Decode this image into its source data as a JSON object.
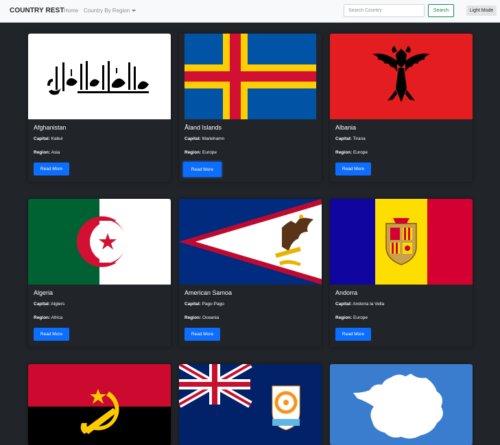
{
  "navbar": {
    "brand": "COUNTRY REST",
    "home": "Home",
    "region_dropdown": "Country By Region",
    "search_placeholder": "Search Country",
    "search_button": "Search",
    "mode_button": "Light Mode"
  },
  "labels": {
    "capital": "Capital:",
    "region": "Region:",
    "read_more": "Read More"
  },
  "countries": [
    {
      "name": "Afghanistan",
      "capital": "Kabul",
      "region": "Asia",
      "flag_icon": "afghanistan-flag"
    },
    {
      "name": "Åland Islands",
      "capital": "Mariehamn",
      "region": "Europe",
      "flag_icon": "aland-islands-flag"
    },
    {
      "name": "Albania",
      "capital": "Tirana",
      "region": "Europe",
      "flag_icon": "albania-flag"
    },
    {
      "name": "Algeria",
      "capital": "Algiers",
      "region": "Africa",
      "flag_icon": "algeria-flag"
    },
    {
      "name": "American Samoa",
      "capital": "Pago Pago",
      "region": "Oceania",
      "flag_icon": "american-samoa-flag"
    },
    {
      "name": "Andorra",
      "capital": "Andorra la Vella",
      "region": "Europe",
      "flag_icon": "andorra-flag"
    },
    {
      "flag_icon": "angola-flag"
    },
    {
      "flag_icon": "anguilla-flag"
    },
    {
      "flag_icon": "antarctica-flag"
    }
  ],
  "colors": {
    "page_bg": "#212529",
    "navbar_bg": "#f8f9fa",
    "primary": "#0d6efd",
    "success": "#198754"
  }
}
